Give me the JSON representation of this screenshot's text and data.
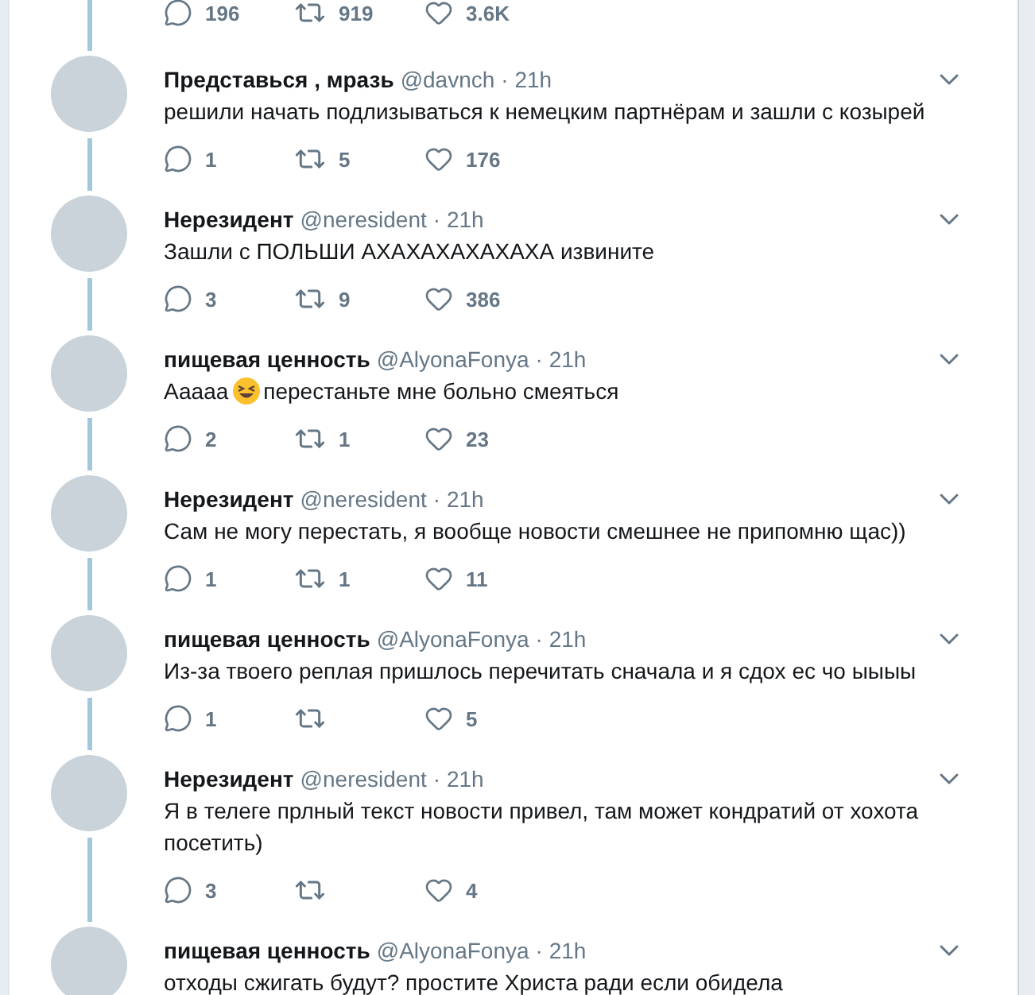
{
  "previous_tweet": {
    "replies": "196",
    "retweets": "919",
    "likes": "3.6K"
  },
  "tweets": [
    {
      "name": "Представься , мразь",
      "handle": "@davnch",
      "time": "· 21h",
      "segments": [
        {
          "kind": "text",
          "text": "решили начать подлизываться к немецким партнёрам и зашли с козырей"
        }
      ],
      "replies": "1",
      "retweets": "5",
      "likes": "176"
    },
    {
      "name": "Нерезидент",
      "handle": "@neresident",
      "time": "· 21h",
      "segments": [
        {
          "kind": "text",
          "text": "Зашли с ПОЛЬШИ АХАХАХАХАХАХА извините"
        }
      ],
      "replies": "3",
      "retweets": "9",
      "likes": "386"
    },
    {
      "name": "пищевая ценность",
      "handle": "@AlyonaFonya",
      "time": "· 21h",
      "segments": [
        {
          "kind": "text",
          "text": "Ааааа"
        },
        {
          "kind": "emoji"
        },
        {
          "kind": "text",
          "text": "перестаньте мне больно смеяться"
        }
      ],
      "replies": "2",
      "retweets": "1",
      "likes": "23"
    },
    {
      "name": "Нерезидент",
      "handle": "@neresident",
      "time": "· 21h",
      "segments": [
        {
          "kind": "text",
          "text": "Сам не могу перестать, я вообще новости смешнее не припомню щас))"
        }
      ],
      "replies": "1",
      "retweets": "1",
      "likes": "11"
    },
    {
      "name": "пищевая ценность",
      "handle": "@AlyonaFonya",
      "time": "· 21h",
      "segments": [
        {
          "kind": "text",
          "text": "Из-за твоего реплая пришлось перечитать сначала и я сдох ес чо ыыыы"
        }
      ],
      "replies": "1",
      "likes": "5"
    },
    {
      "name": "Нерезидент",
      "handle": "@neresident",
      "time": "· 21h",
      "segments": [
        {
          "kind": "text",
          "text": "Я в телеге прлный текст новости привел, там может кондратий от хохота посетить)"
        }
      ],
      "replies": "3",
      "likes": "4"
    },
    {
      "name": "пищевая ценность",
      "handle": "@AlyonaFonya",
      "time": "· 21h",
      "segments": [
        {
          "kind": "text",
          "text": "отходы сжигать будут? простите Христа ради если обидела"
        }
      ]
    }
  ]
}
